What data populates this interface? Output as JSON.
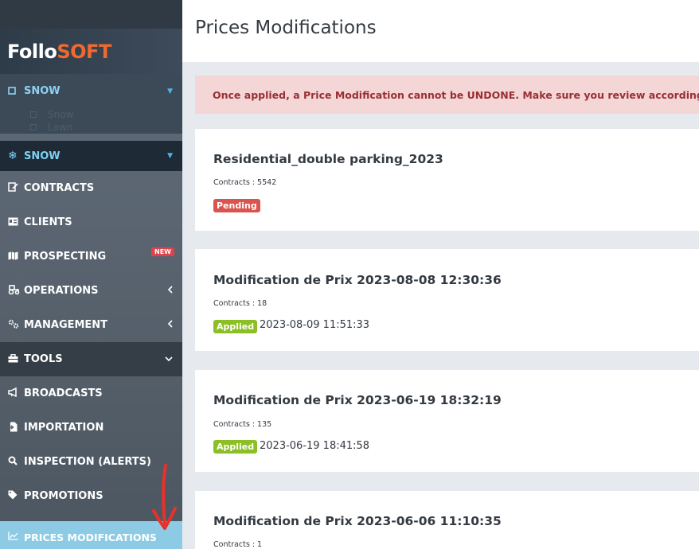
{
  "brand": {
    "logo_part1": "Follo",
    "logo_part2": "SOFT"
  },
  "sidebar": {
    "group_header": {
      "icon": "square-icon",
      "label": "SNOW"
    },
    "sub_items": [
      "Snow",
      "Lawn"
    ],
    "selected": {
      "icon": "snowflake-icon",
      "label": "SNOW"
    },
    "items": [
      {
        "label": "CONTRACTS",
        "icon": "edit-document-icon"
      },
      {
        "label": "CLIENTS",
        "icon": "id-card-icon"
      },
      {
        "label": "PROSPECTING",
        "icon": "map-icon",
        "badge": "NEW"
      },
      {
        "label": "OPERATIONS",
        "icon": "tractor-icon"
      },
      {
        "label": "MANAGEMENT",
        "icon": "cogs-icon"
      },
      {
        "label": "TOOLS",
        "icon": "toolbox-icon"
      },
      {
        "label": "BROADCASTS",
        "icon": "megaphone-icon"
      },
      {
        "label": "IMPORTATION",
        "icon": "file-import-icon"
      },
      {
        "label": "INSPECTION (ALERTS)",
        "icon": "search-icon"
      },
      {
        "label": "PROMOTIONS",
        "icon": "tag-icon"
      },
      {
        "label": "PRICES MODIFICATIONS",
        "icon": "chart-line-icon"
      }
    ]
  },
  "page": {
    "title": "Prices Modifications",
    "alert": "Once applied, a Price Modification cannot be UNDONE. Make sure you review accordingly."
  },
  "cards": [
    {
      "title": "Residential_double parking_2023",
      "contracts": "Contracts : 5542",
      "status": "Pending",
      "applied_at": ""
    },
    {
      "title": "Modification de Prix 2023-08-08 12:30:36",
      "contracts": "Contracts : 18",
      "status": "Applied",
      "applied_at": "2023-08-09 11:51:33"
    },
    {
      "title": "Modification de Prix 2023-06-19 18:32:19",
      "contracts": "Contracts : 135",
      "status": "Applied",
      "applied_at": "2023-06-19 18:41:58"
    },
    {
      "title": "Modification de Prix 2023-06-06 11:10:35",
      "contracts": "Contracts : 1",
      "status": "",
      "applied_at": ""
    }
  ],
  "colors": {
    "pending": "#d9534f",
    "applied": "#8cbf26",
    "active_item": "#8dcbe5",
    "logo_accent": "#f06a2f",
    "annotation_arrow": "#e8312b"
  }
}
